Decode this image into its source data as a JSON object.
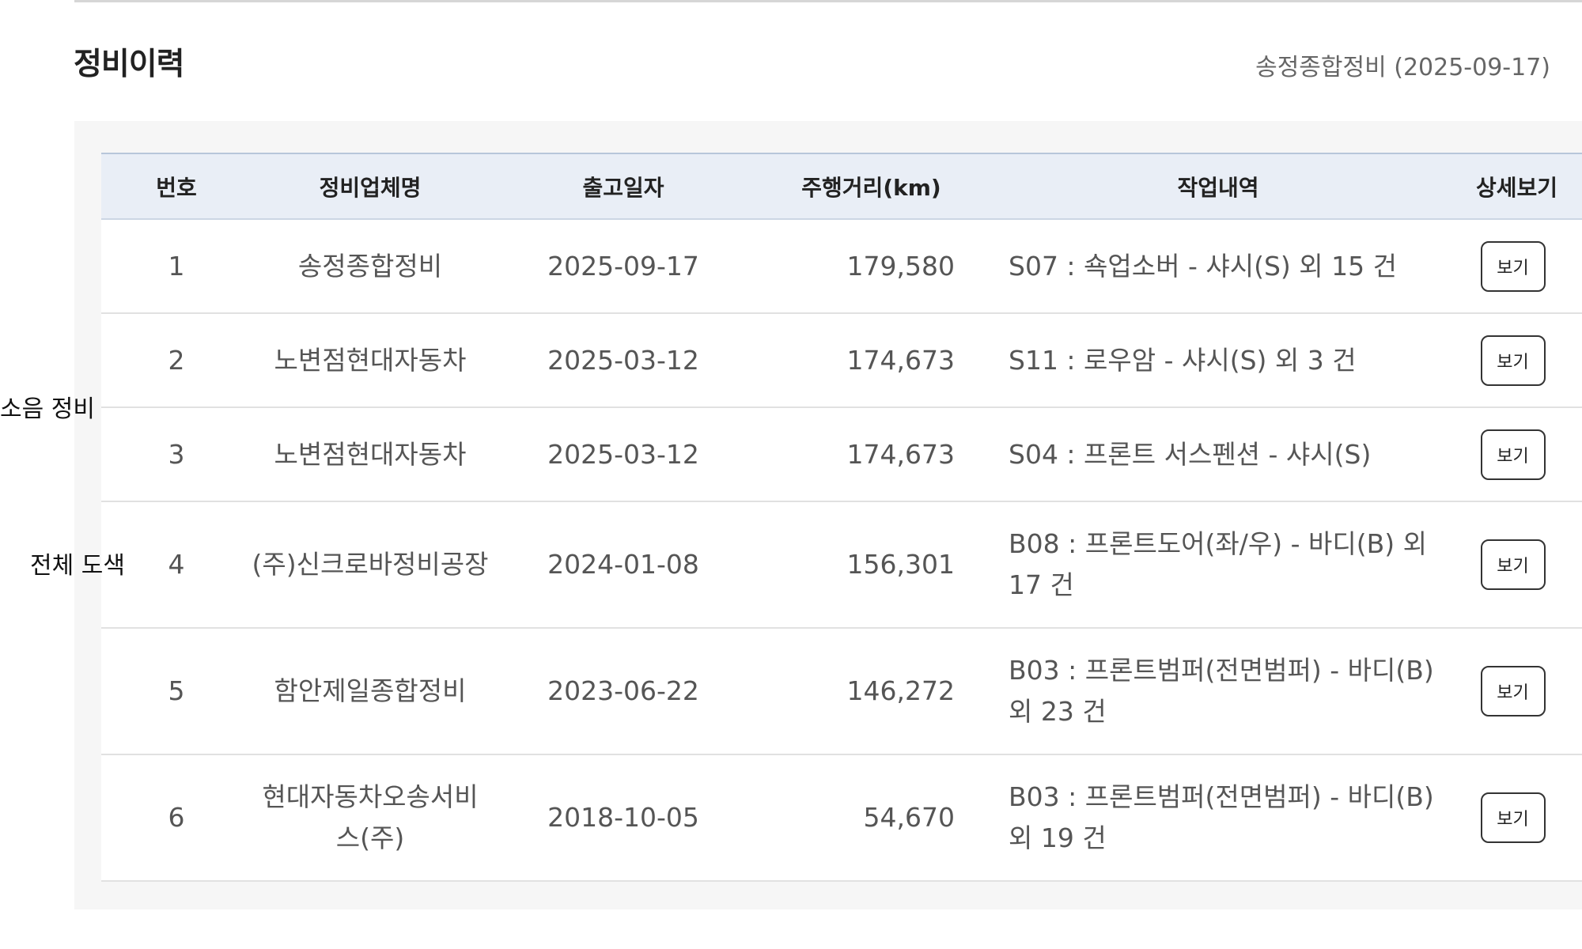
{
  "section": {
    "title": "정비이력",
    "summary": "송정종합정비 (2025-09-17)"
  },
  "side_labels": [
    "소음 정비",
    "전체 도색"
  ],
  "table": {
    "headers": [
      "번호",
      "정비업체명",
      "출고일자",
      "주행거리(km)",
      "작업내역",
      "상세보기"
    ],
    "rows": [
      {
        "no": "1",
        "shop": "송정종합정비",
        "date": "2025-09-17",
        "mileage": "179,580",
        "work": "S07 : 쇽업소버 - 샤시(S) 외 15 건",
        "action": "보기"
      },
      {
        "no": "2",
        "shop": "노변점현대자동차",
        "date": "2025-03-12",
        "mileage": "174,673",
        "work": "S11 : 로우암 - 샤시(S) 외 3 건",
        "action": "보기"
      },
      {
        "no": "3",
        "shop": "노변점현대자동차",
        "date": "2025-03-12",
        "mileage": "174,673",
        "work": "S04 : 프론트 서스펜션 - 샤시(S)",
        "action": "보기"
      },
      {
        "no": "4",
        "shop": "(주)신크로바정비공장",
        "date": "2024-01-08",
        "mileage": "156,301",
        "work": "B08 : 프론트도어(좌/우) - 바디(B) 외 17 건",
        "action": "보기"
      },
      {
        "no": "5",
        "shop": "함안제일종합정비",
        "date": "2023-06-22",
        "mileage": "146,272",
        "work": "B03 : 프론트범퍼(전면범퍼) - 바디(B) 외 23 건",
        "action": "보기"
      },
      {
        "no": "6",
        "shop": "현대자동차오송서비스(주)",
        "date": "2018-10-05",
        "mileage": "54,670",
        "work": "B03 : 프론트범퍼(전면범퍼) - 바디(B) 외 19 건",
        "action": "보기"
      }
    ]
  }
}
